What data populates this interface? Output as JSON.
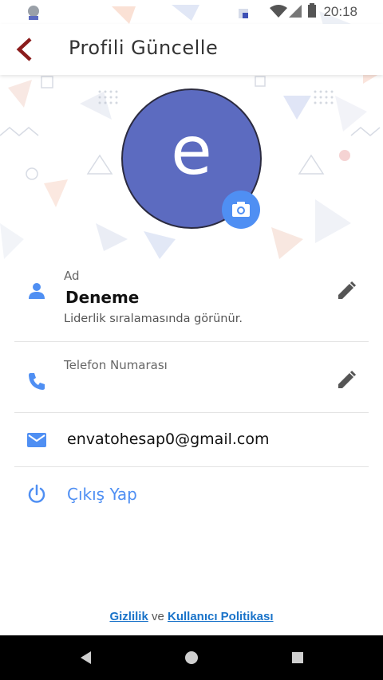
{
  "status_bar": {
    "time": "20:18"
  },
  "header": {
    "title": "Profili Güncelle"
  },
  "avatar": {
    "initial": "e",
    "color": "#5c6bc0"
  },
  "name_field": {
    "label": "Ad",
    "value": "Deneme",
    "hint": "Liderlik sıralamasında görünür."
  },
  "phone_field": {
    "label": "Telefon Numarası"
  },
  "email": {
    "value": "envatohesap0@gmail.com"
  },
  "logout": {
    "label": "Çıkış Yap"
  },
  "footer": {
    "privacy": "Gizlilik",
    "conjunction": "ve",
    "user_policy": "Kullanıcı Politikası"
  },
  "icons": {
    "back": "chevron-left-icon",
    "camera": "camera-icon",
    "person": "person-icon",
    "phone": "phone-icon",
    "email": "email-icon",
    "power": "power-icon",
    "edit": "pencil-icon"
  },
  "colors": {
    "accent": "#4f8ff3",
    "back_arrow": "#8b1c1c",
    "link": "#1a73c9",
    "nav_bar": "#000000"
  }
}
